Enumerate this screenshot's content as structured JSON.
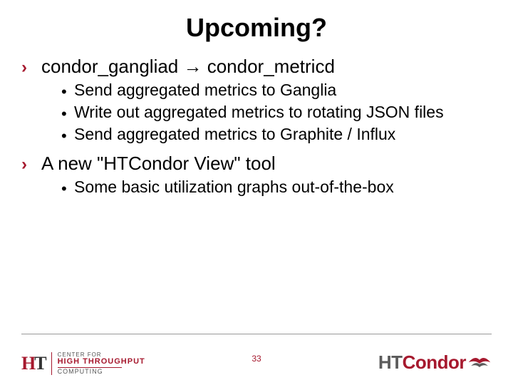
{
  "title": "Upcoming?",
  "bullets": {
    "item1": {
      "label": "condor_gangliad → condor_metricd",
      "subs": [
        "Send aggregated metrics to Ganglia",
        "Write out aggregated metrics to rotating JSON files",
        "Send aggregated metrics to Graphite / Influx"
      ]
    },
    "item2": {
      "label": "A new \"HTCondor View\" tool",
      "subs": [
        "Some basic utilization graphs out-of-the-box"
      ]
    }
  },
  "page_number": "33",
  "logo_left": {
    "line1": "CENTER FOR",
    "line2": "HIGH THROUGHPUT",
    "line3": "COMPUTING",
    "mark_h": "H",
    "mark_t": "T"
  },
  "logo_right": {
    "ht": "HT",
    "condor": "Condor"
  }
}
